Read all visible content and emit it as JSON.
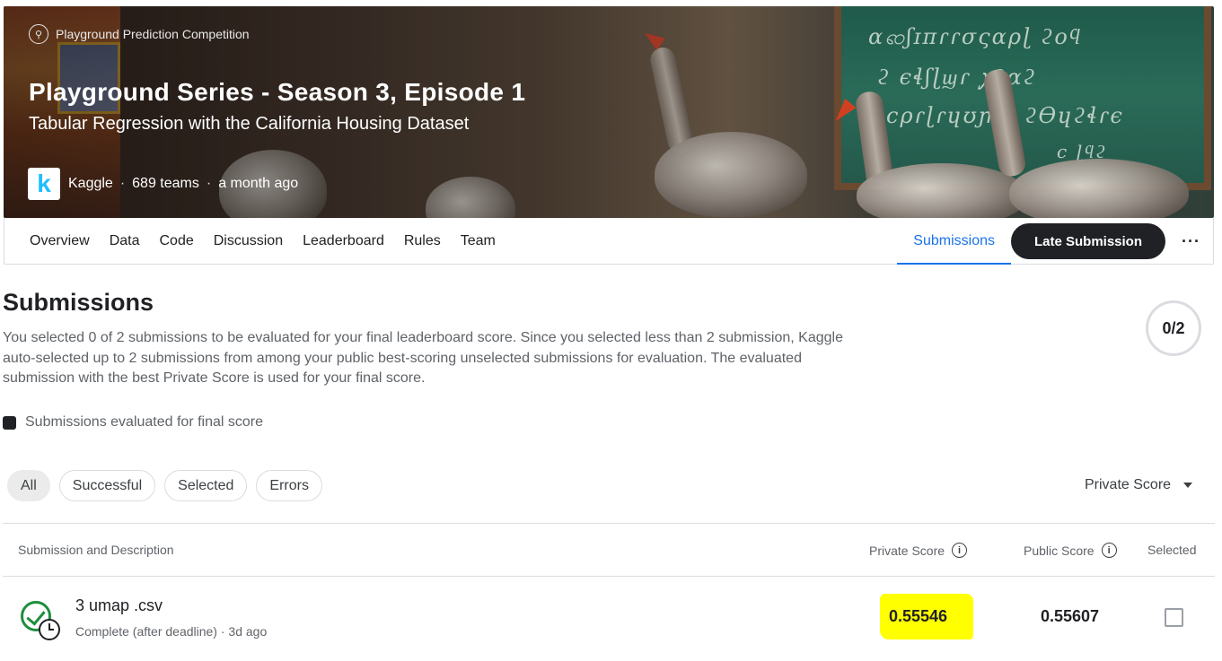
{
  "header": {
    "competition_type": "Playground Prediction Competition",
    "competition_type_icon": "bicycle-icon",
    "title": "Playground Series - Season 3, Episode 1",
    "subtitle": "Tabular Regression with the California Housing Dataset",
    "host": "Kaggle",
    "logo_letter": "k",
    "teams": "689 teams",
    "time": "a month ago",
    "separator": "·"
  },
  "nav": {
    "tabs": [
      {
        "label": "Overview"
      },
      {
        "label": "Data"
      },
      {
        "label": "Code"
      },
      {
        "label": "Discussion"
      },
      {
        "label": "Leaderboard"
      },
      {
        "label": "Rules"
      },
      {
        "label": "Team"
      }
    ],
    "active_tab": "Submissions",
    "late_submission_label": "Late Submission",
    "more_label": "···"
  },
  "page": {
    "heading": "Submissions",
    "description": "You selected 0 of 2 submissions to be evaluated for your final leaderboard score. Since you selected less than 2 submission, Kaggle auto-selected up to 2 submissions from among your public best-scoring unselected submissions for evaluation. The evaluated submission with the best Private Score is used for your final score.",
    "counter": "0/2",
    "legend": "Submissions evaluated for final score"
  },
  "filters": {
    "chips": [
      "All",
      "Successful",
      "Selected",
      "Errors"
    ],
    "active": "All",
    "sort_label": "Private Score"
  },
  "table": {
    "columns": {
      "submission": "Submission and Description",
      "private": "Private Score",
      "public": "Public Score",
      "selected": "Selected"
    },
    "rows": [
      {
        "file": "3 umap .csv",
        "status_text": "Complete (after deadline) · 3d ago",
        "private_score": "0.55546",
        "public_score": "0.55607",
        "selected": false
      }
    ]
  },
  "colors": {
    "accent": "#1a73e8",
    "success": "#1e8e3e",
    "highlight": "#ffff00",
    "dark": "#202124"
  }
}
